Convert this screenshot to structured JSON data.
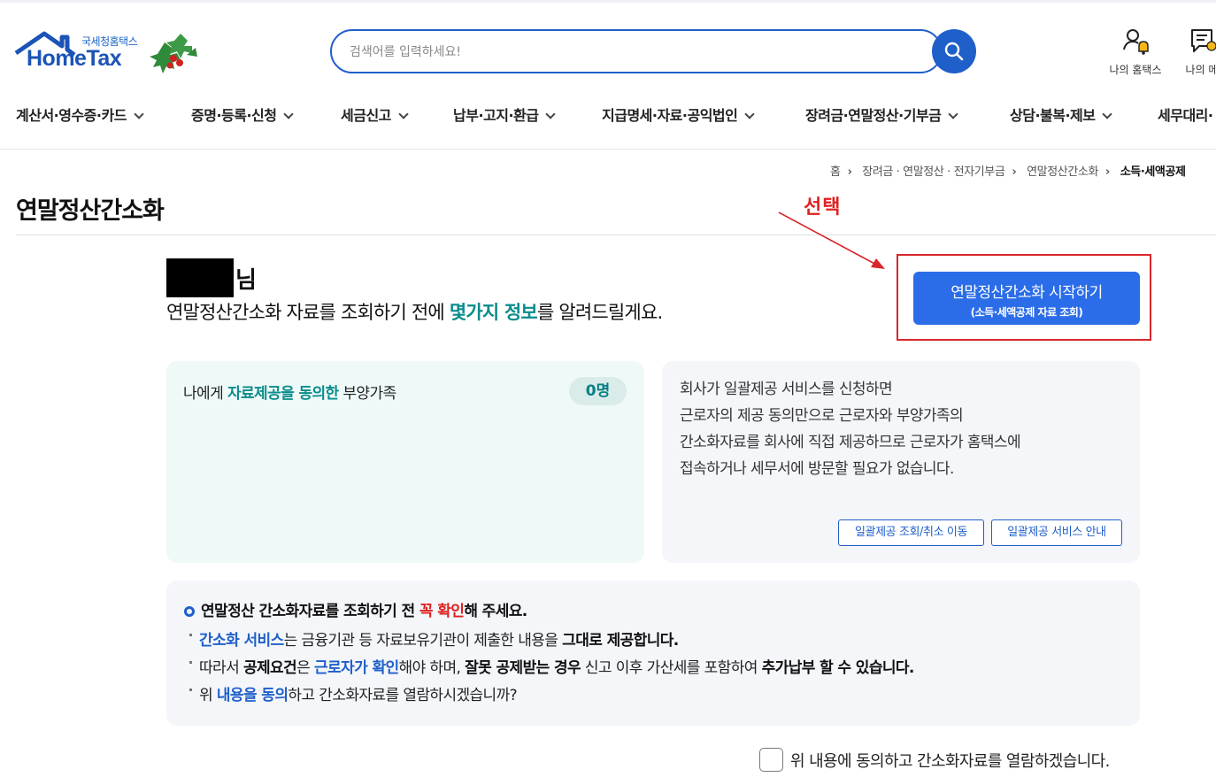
{
  "header": {
    "logo_sub": "국세청홈택스",
    "logo_main": "HomeTax",
    "search_placeholder": "검색어를 입력하세요!",
    "utils": [
      {
        "icon": "user-bell-icon",
        "label": "나의 홈택스"
      },
      {
        "icon": "message-icon",
        "label": "나의 메"
      }
    ]
  },
  "gnb": [
    "계산서·영수증·카드",
    "증명·등록·신청",
    "세금신고",
    "납부·고지·환급",
    "지급명세·자료·공익법인",
    "장려금·연말정산·기부금",
    "상담·불복·제보",
    "세무대리·"
  ],
  "breadcrumb": {
    "items": [
      "홈",
      "장려금 · 연말정산 · 전자기부금",
      "연말정산간소화"
    ],
    "current": "소득·세액공제"
  },
  "page": {
    "title": "연말정산간소화",
    "annotation": "선택",
    "start_button": {
      "line1": "연말정산간소화 시작하기",
      "line2": "(소득·세액공제 자료 조회)"
    },
    "name_suffix": "님",
    "greeting": {
      "before": "연말정산간소화 자료를 조회하기 전에 ",
      "highlight": "몇가지 정보",
      "after": "를 알려드릴게요."
    }
  },
  "card_left": {
    "before": "나에게 ",
    "highlight": "자료제공을 동의한",
    "after": " 부양가족",
    "count": "0명"
  },
  "card_right": {
    "lines": [
      "회사가 일괄제공 서비스를 신청하면",
      "근로자의 제공 동의만으로 근로자와 부양가족의",
      "간소화자료를 회사에 직접 제공하므로 근로자가 홈택스에",
      "접속하거나 세무서에 방문할 필요가 없습니다."
    ],
    "buttons": [
      "일괄제공 조회/취소 이동",
      "일괄제공 서비스 안내"
    ]
  },
  "notice": {
    "title_before": "연말정산 간소화자료를 조회하기 전 ",
    "title_red": "꼭 확인",
    "title_after": "해 주세요.",
    "line1": {
      "blue": "간소화 서비스",
      "mid": "는 금융기관 등 자료보유기관이 제출한 내용을 ",
      "bold": "그대로 제공합니다."
    },
    "line2": {
      "p1": "따라서 ",
      "b1": "공제요건",
      "p2": "은 ",
      "blue": "근로자가 확인",
      "p3": "해야 하며, ",
      "b2": "잘못 공제받는 경우",
      "p4": " 신고 이후 가산세를 포함하여 ",
      "b3": "추가납부 할 수 있습니다."
    },
    "line3": {
      "p1": "위 ",
      "blue": "내용을 동의",
      "p2": "하고 간소화자료를 열람하시겠습니까?"
    }
  },
  "agree_label": "위 내용에 동의하고 간소화자료를 열람하겠습니다.",
  "colors": {
    "primary": "#1f5fc9",
    "accent_teal": "#0b8c8c",
    "annotation_red": "#e02020",
    "button_blue": "#2b6de8"
  }
}
